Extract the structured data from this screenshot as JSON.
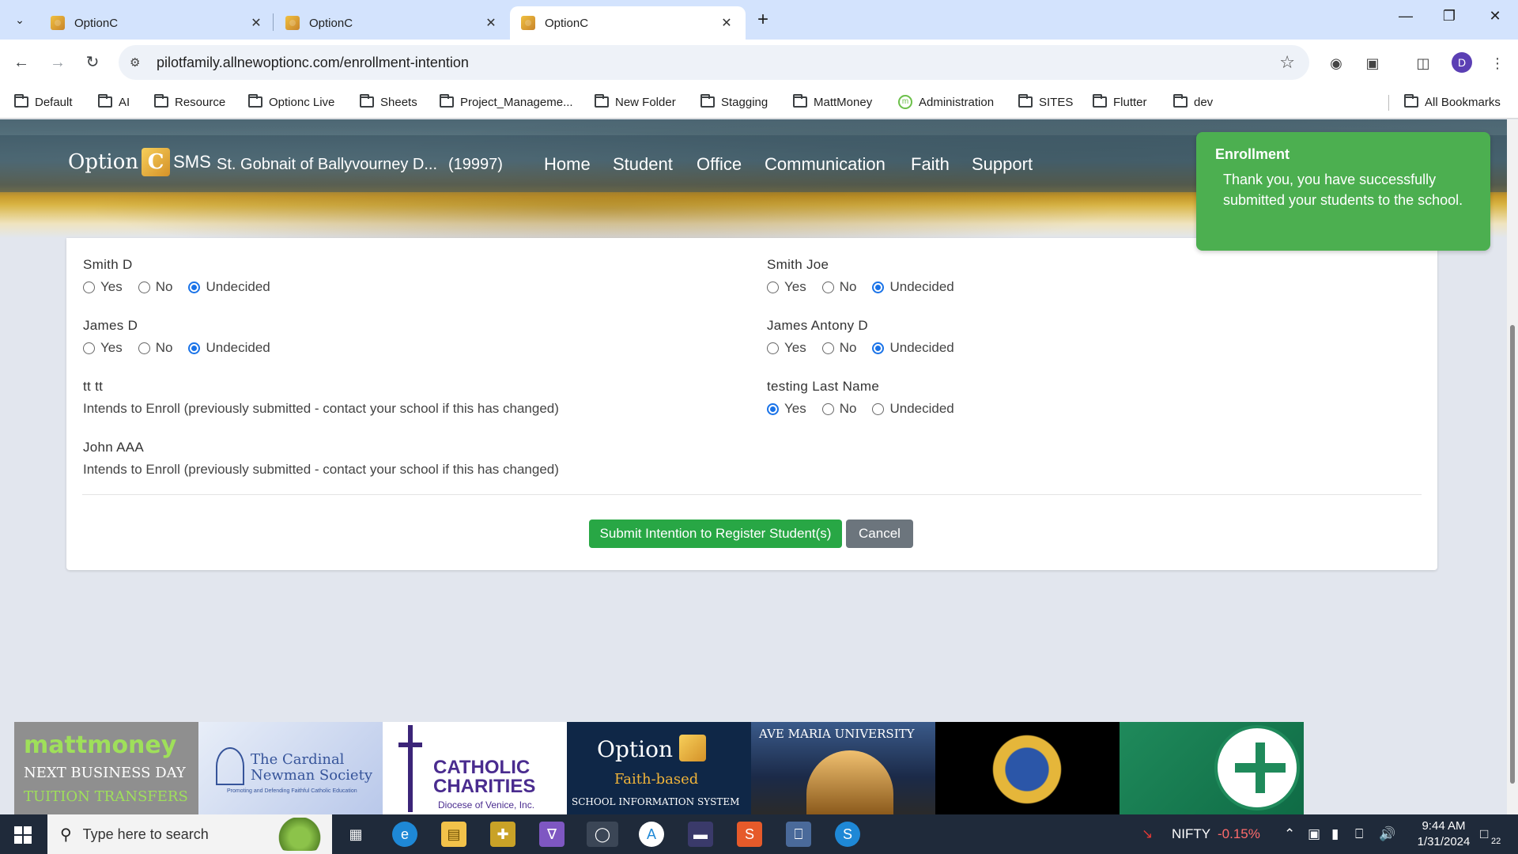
{
  "browser": {
    "tabs": [
      {
        "title": "OptionC"
      },
      {
        "title": "OptionC"
      },
      {
        "title": "OptionC"
      }
    ],
    "url": "pilotfamily.allnewoptionc.com/enrollment-intention",
    "profile_initial": "D",
    "bookmarks": [
      "Default",
      "AI",
      "Resource",
      "Optionc Live",
      "Sheets",
      "Project_Manageme...",
      "New Folder",
      "Stagging",
      "MattMoney",
      "Administration",
      "SITES",
      "Flutter",
      "dev"
    ],
    "all_bookmarks": "All Bookmarks"
  },
  "app": {
    "logo_word": "Option",
    "logo_letter": "C",
    "logo_suffix": "SMS",
    "school_name": "St. Gobnait of Ballyvourney D...",
    "school_id": "(19997)",
    "menu": [
      "Home",
      "Student",
      "Office",
      "Communication",
      "Faith",
      "Support"
    ]
  },
  "toast": {
    "title": "Enrollment",
    "message": "Thank you, you have successfully submitted your students to the school."
  },
  "radio_labels": {
    "yes": "Yes",
    "no": "No",
    "undecided": "Undecided"
  },
  "students": [
    {
      "name": "Smith D",
      "choice": "undecided"
    },
    {
      "name": "Smith Joe",
      "choice": "undecided"
    },
    {
      "name": "James D",
      "choice": "undecided"
    },
    {
      "name": "James Antony D",
      "choice": "undecided"
    },
    {
      "name": "tt tt",
      "note": "Intends to Enroll (previously submitted - contact your school if this has changed)"
    },
    {
      "name": "testing Last Name",
      "choice": "yes"
    },
    {
      "name": "John AAA",
      "note": "Intends to Enroll (previously submitted - contact your school if this has changed)"
    }
  ],
  "actions": {
    "submit": "Submit Intention to Register Student(s)",
    "cancel": "Cancel"
  },
  "sponsors": {
    "mattmoney": {
      "brand": "mattmoney",
      "line1": "NEXT BUSINESS DAY",
      "line2": "TUITION TRANSFERS"
    },
    "newman": {
      "name": "The Cardinal Newman Society",
      "tagline": "Promoting and Defending Faithful Catholic Education"
    },
    "charities": {
      "name": "CATHOLIC CHARITIES",
      "sub": "Diocese of Venice, Inc."
    },
    "optionc": {
      "word": "Option",
      "tag": "Faith-based",
      "sub": "SCHOOL INFORMATION SYSTEM"
    },
    "avemaria": {
      "name": "AVE MARIA UNIVERSITY"
    }
  },
  "taskbar": {
    "search_placeholder": "Type here to search",
    "ticker": "NIFTY",
    "ticker_change": "-0.15%",
    "time": "9:44 AM",
    "date": "1/31/2024",
    "notifications": "22"
  },
  "colors": {
    "accent": "#1a73e8",
    "success": "#28a745",
    "toast": "#4caf50",
    "secondary": "#6c757d",
    "ticker_negative": "#ff6b6b"
  }
}
